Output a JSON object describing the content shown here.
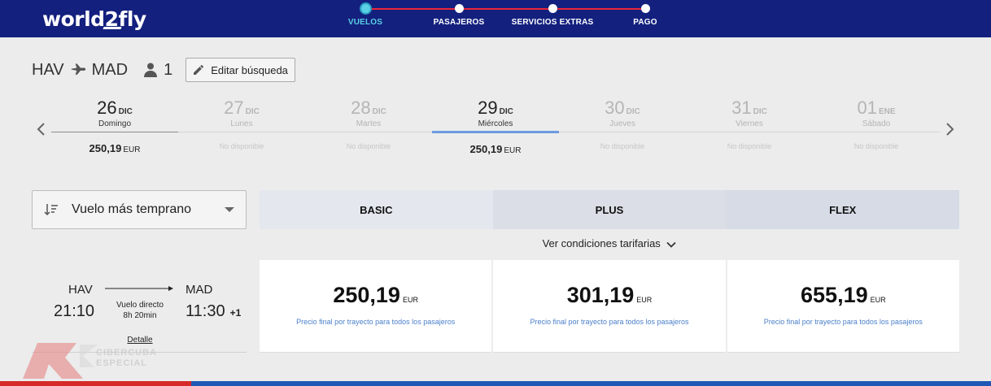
{
  "brand": {
    "logo_text_a": "world",
    "logo_text_b": "2",
    "logo_text_c": "fly"
  },
  "steps": [
    {
      "label": "VUELOS",
      "active": true
    },
    {
      "label": "PASAJEROS",
      "active": false
    },
    {
      "label": "SERVICIOS EXTRAS",
      "active": false
    },
    {
      "label": "PAGO",
      "active": false
    }
  ],
  "route": {
    "origin": "HAV",
    "destination": "MAD",
    "passengers": "1",
    "edit_label": "Editar búsqueda"
  },
  "dates": [
    {
      "day": "26",
      "month": "DIC",
      "weekday": "Domingo",
      "price": "250,19",
      "currency": "EUR",
      "available": true
    },
    {
      "day": "27",
      "month": "DIC",
      "weekday": "Lunes",
      "price": "No disponible",
      "available": false
    },
    {
      "day": "28",
      "month": "DIC",
      "weekday": "Martes",
      "price": "No disponible",
      "available": false
    },
    {
      "day": "29",
      "month": "DIC",
      "weekday": "Miércoles",
      "price": "250,19",
      "currency": "EUR",
      "available": true,
      "selected": true
    },
    {
      "day": "30",
      "month": "DIC",
      "weekday": "Jueves",
      "price": "No disponible",
      "available": false
    },
    {
      "day": "31",
      "month": "DIC",
      "weekday": "Viernes",
      "price": "No disponible",
      "available": false
    },
    {
      "day": "01",
      "month": "ENE",
      "weekday": "Sábado",
      "price": "No disponible",
      "available": false
    }
  ],
  "sort": {
    "label": "Vuelo más temprano"
  },
  "fare_tabs": [
    "BASIC",
    "PLUS",
    "FLEX"
  ],
  "conditions_label": "Ver condiciones tarifarias",
  "flight": {
    "from": "HAV",
    "to": "MAD",
    "departure": "21:10",
    "arrival": "11:30",
    "day_offset": "+1",
    "type": "Vuelo directo",
    "duration": "8h 20min",
    "detail_label": "Detalle"
  },
  "fares": [
    {
      "amount": "250,19",
      "currency": "EUR",
      "note": "Precio final por trayecto para todos los pasajeros"
    },
    {
      "amount": "301,19",
      "currency": "EUR",
      "note": "Precio final por trayecto para todos los pasajeros"
    },
    {
      "amount": "655,19",
      "currency": "EUR",
      "note": "Precio final por trayecto para todos los pasajeros"
    }
  ],
  "watermark": {
    "line1": "CIBERCUBA",
    "line2": "ESPECIAL"
  },
  "colors": {
    "header": "#13207e",
    "step_active": "#5ad1e6",
    "step_line": "#e8273a",
    "selected_day": "#6c9be0",
    "note_link": "#4a7fc9"
  },
  "icons": [
    "plane-icon",
    "person-icon",
    "pencil-icon",
    "chevron-left-icon",
    "chevron-right-icon",
    "sort-icon",
    "caret-down-icon",
    "chevron-down-icon",
    "arrow-right-icon"
  ]
}
